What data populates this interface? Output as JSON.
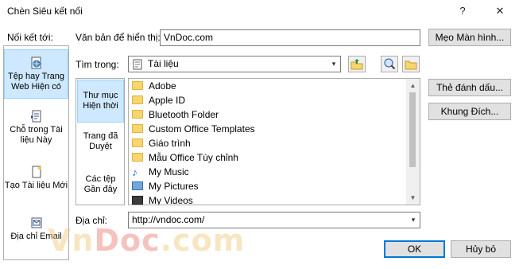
{
  "window": {
    "title": "Chèn Siêu kết nối",
    "help_glyph": "?",
    "close_glyph": "✕"
  },
  "link_to": {
    "label": "Nối kết tới:",
    "items": [
      {
        "label": "Tệp hay Trang Web Hiện có",
        "icon": "globe-page-icon",
        "selected": true
      },
      {
        "label": "Chỗ trong Tài liệu Này",
        "icon": "document-place-icon",
        "selected": false
      },
      {
        "label": "Tạo Tài liệu Mới",
        "icon": "new-document-icon",
        "selected": false
      },
      {
        "label": "Địa chỉ Email",
        "icon": "email-icon",
        "selected": false
      }
    ]
  },
  "text_to_display": {
    "label": "Văn bản để hiển thị:",
    "value": "VnDoc.com"
  },
  "look_in": {
    "label": "Tìm trong:",
    "value": "Tài liệu",
    "options_arrow": "▾"
  },
  "look_in_panel": {
    "items": [
      {
        "label": "Thư mục Hiện thời",
        "selected": true
      },
      {
        "label": "Trang đã Duyệt",
        "selected": false
      },
      {
        "label": "Các tệp Gần đây",
        "selected": false
      }
    ]
  },
  "files": [
    {
      "name": "Adobe",
      "icon": "folder-icon"
    },
    {
      "name": "Apple ID",
      "icon": "folder-icon"
    },
    {
      "name": "Bluetooth Folder",
      "icon": "folder-icon"
    },
    {
      "name": "Custom Office Templates",
      "icon": "folder-icon"
    },
    {
      "name": "Giáo trình",
      "icon": "folder-icon"
    },
    {
      "name": "Mẫu Office Tùy chỉnh",
      "icon": "folder-icon"
    },
    {
      "name": "My Music",
      "icon": "music-icon"
    },
    {
      "name": "My Pictures",
      "icon": "pictures-icon"
    },
    {
      "name": "My Videos",
      "icon": "videos-icon"
    }
  ],
  "address": {
    "label": "Địa chỉ:",
    "value": "http://vndoc.com/"
  },
  "buttons": {
    "screen_tip": "Mẹo Màn hình...",
    "bookmark": "Thẻ đánh dấu...",
    "target_frame": "Khung Đích...",
    "ok": "OK",
    "cancel": "Hủy bỏ"
  },
  "watermark": {
    "part1": "Vn",
    "part2": "Doc",
    "part3": ".com"
  },
  "colors": {
    "selection": "#cde8ff",
    "selection_border": "#99d1ff",
    "default_button_border": "#0078d7",
    "folder": "#f7d56f"
  }
}
